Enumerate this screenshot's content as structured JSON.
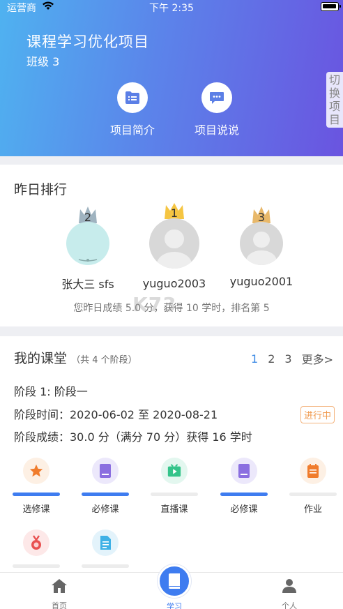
{
  "status_bar": {
    "carrier": "运营商",
    "time": "下午 2:35"
  },
  "header": {
    "project_title": "课程学习优化项目",
    "class_name": "班级 3",
    "switch_label": "切换项目",
    "buttons": [
      {
        "label": "项目简介",
        "icon": "list-doc-icon"
      },
      {
        "label": "项目说说",
        "icon": "chat-bubble-icon"
      }
    ]
  },
  "ranking": {
    "title": "昨日排行",
    "podium": [
      {
        "rank": "2",
        "name": "张大三 sfs",
        "crown_color": "#9fb3c0"
      },
      {
        "rank": "1",
        "name": "yuguo2003",
        "crown_color": "#f5c542"
      },
      {
        "rank": "3",
        "name": "yuguo2001",
        "crown_color": "#e8b86a"
      }
    ],
    "summary": "您昨日成绩 5.0 分，获得 10 学时，排名第 5"
  },
  "my_class": {
    "title": "我的课堂",
    "stage_count": "（共 4 个阶段）",
    "stage_tabs": [
      "1",
      "2",
      "3",
      "更多>"
    ],
    "active_stage_tab": "1",
    "stage_name": "阶段 1:  阶段一",
    "stage_time": "阶段时间：2020-06-02 至 2020-08-21",
    "stage_score": "阶段成绩：30.0 分（满分 70 分）获得 16 学时",
    "status": "进行中",
    "courses": [
      {
        "label": "选修课",
        "icon": "star-icon",
        "bg": "#fdf0e4",
        "done": true
      },
      {
        "label": "必修课",
        "icon": "book-icon",
        "bg": "#ece8fb",
        "done": true
      },
      {
        "label": "直播课",
        "icon": "play-tv-icon",
        "bg": "#e3f7ef",
        "done": false
      },
      {
        "label": "必修课",
        "icon": "book-icon",
        "bg": "#ece8fb",
        "done": true
      },
      {
        "label": "作业",
        "icon": "notepad-icon",
        "bg": "#fdf0e4",
        "done": false
      },
      {
        "label": "",
        "icon": "medal-icon",
        "bg": "#fde8e8",
        "done": false
      },
      {
        "label": "",
        "icon": "document-icon",
        "bg": "#e3f3fb",
        "done": false
      }
    ]
  },
  "tabbar": {
    "items": [
      {
        "label": "首页",
        "icon": "home-icon"
      },
      {
        "label": "学习",
        "icon": "book-icon"
      },
      {
        "label": "个人",
        "icon": "person-icon"
      }
    ],
    "active": "学习"
  },
  "watermark": "K73"
}
